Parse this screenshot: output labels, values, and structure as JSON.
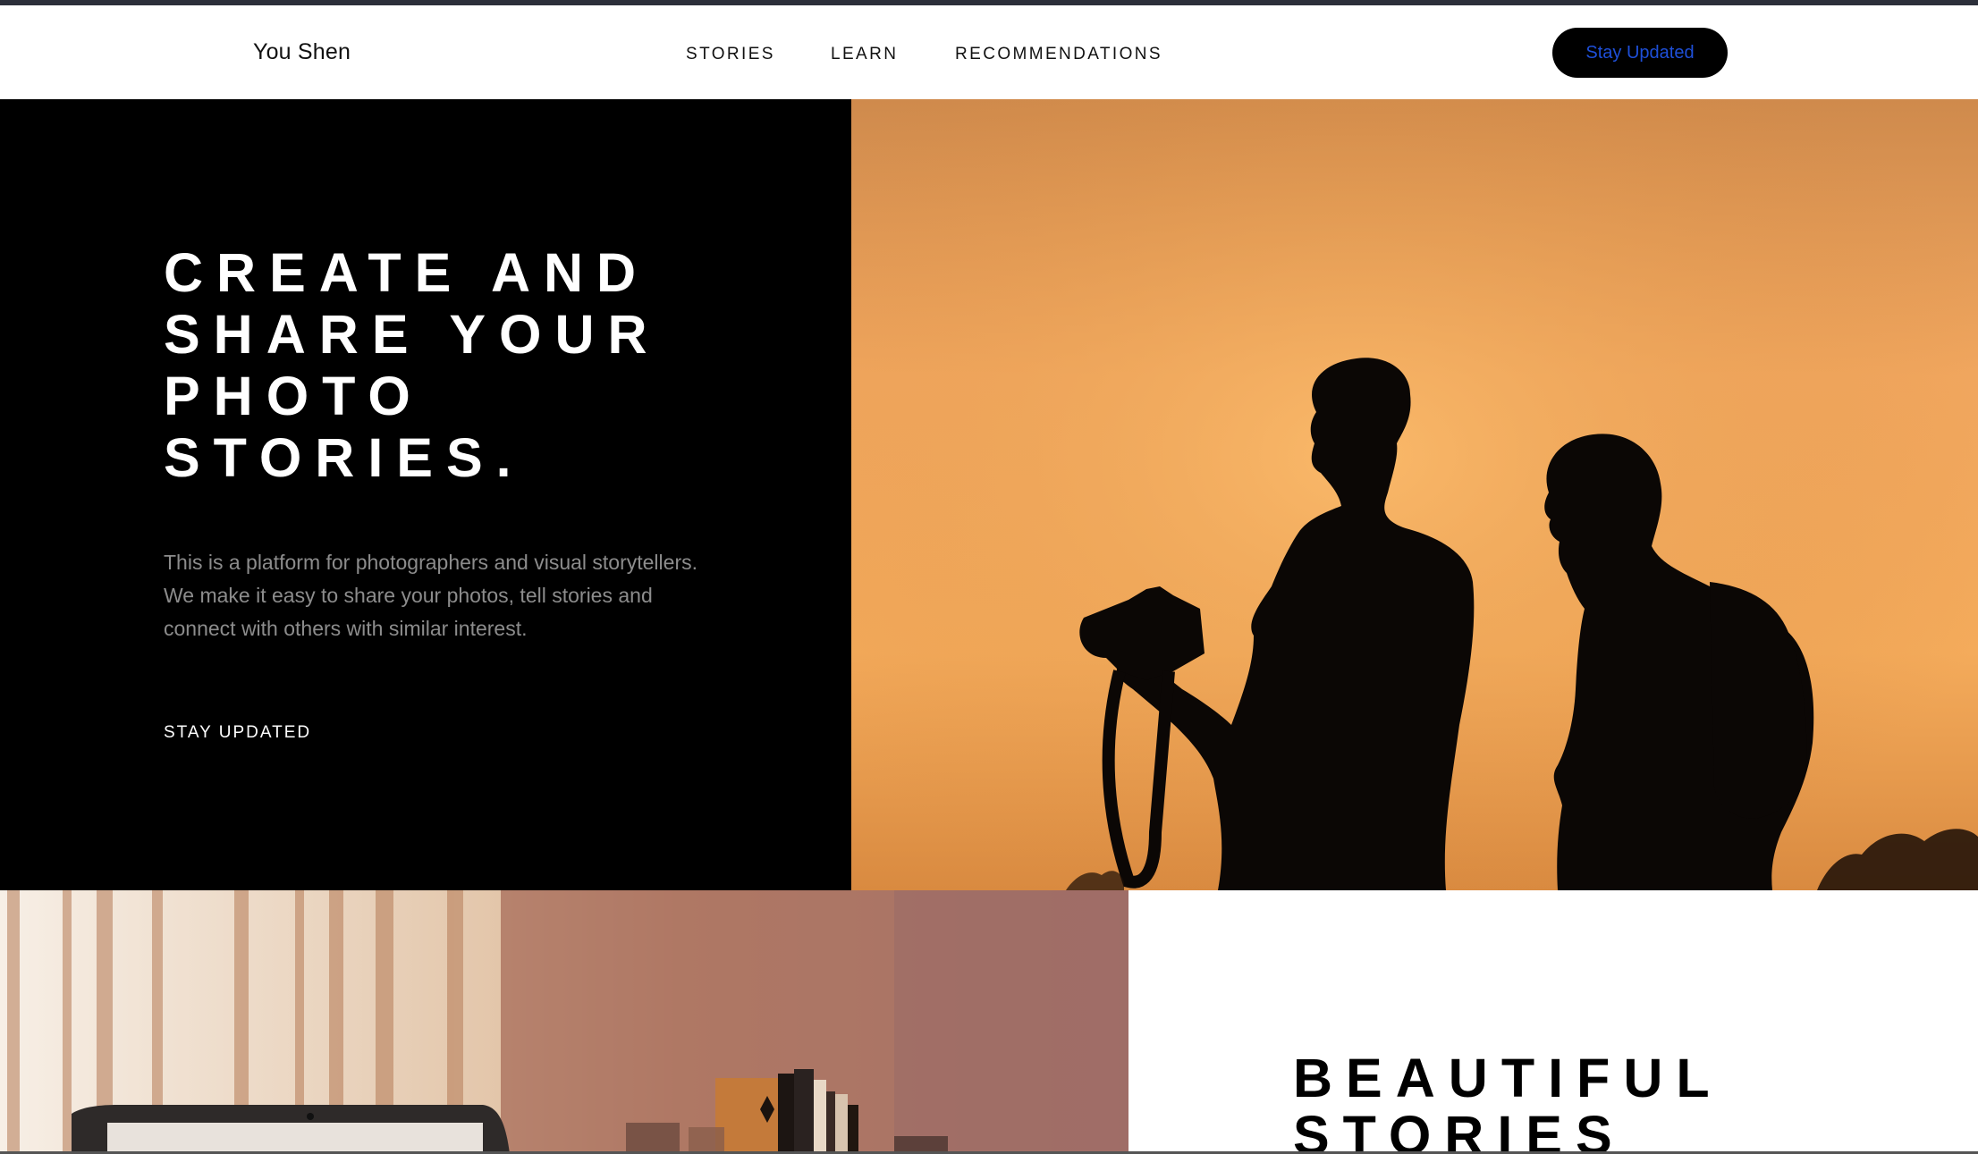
{
  "header": {
    "brand": "You Shen",
    "nav": [
      "STORIES",
      "LEARN",
      "RECOMMENDATIONS"
    ],
    "cta_label": "Stay Updated"
  },
  "hero": {
    "title_lines": [
      "CREATE AND",
      "SHARE YOUR",
      "PHOTO",
      "STORIES."
    ],
    "description": "This is a platform for photographers and visual storytellers. We make it easy to share your photos, tell stories and connect with others with similar interest.",
    "link_label": "STAY UPDATED",
    "image": "silhouette of two men with camera at sunset"
  },
  "section": {
    "title_lines": [
      "BEAUTIFUL",
      "STORIES"
    ],
    "image": "laptop and books on a desk by a window"
  },
  "colors": {
    "cta_text": "#1e4fd8",
    "hero_bg": "#000000",
    "sunset": "#f4ab5b"
  }
}
